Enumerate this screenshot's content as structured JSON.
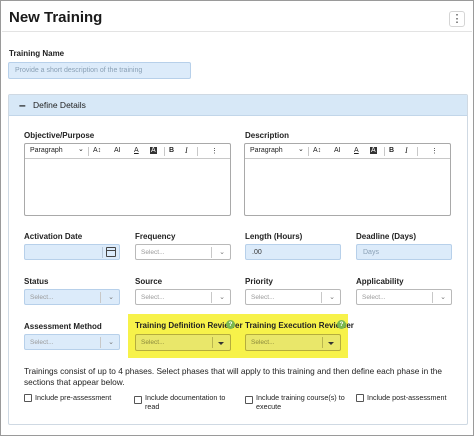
{
  "header": {
    "title": "New Training",
    "menu_icon": "kebab-menu-icon",
    "menu_glyph": "⋮"
  },
  "training_name": {
    "label": "Training Name",
    "placeholder": "Provide a short description of the training"
  },
  "section": {
    "toggle_glyph": "–",
    "title": "Define Details"
  },
  "objective": {
    "label": "Objective/Purpose"
  },
  "description": {
    "label": "Description"
  },
  "editor_toolbar": {
    "paragraph": "Paragraph",
    "chevron": "⌄",
    "font_size": "A↕",
    "font_family": "AI",
    "text_color": "A",
    "highlight": "A",
    "bold": "B",
    "italic": "I",
    "more": "⋮"
  },
  "activation_date": {
    "label": "Activation Date"
  },
  "frequency": {
    "label": "Frequency",
    "placeholder": "Select..."
  },
  "length": {
    "label": "Length (Hours)",
    "value": ".00"
  },
  "deadline": {
    "label": "Deadline (Days)",
    "placeholder": "Days"
  },
  "status": {
    "label": "Status",
    "placeholder": "Select..."
  },
  "source": {
    "label": "Source",
    "placeholder": "Select..."
  },
  "priority": {
    "label": "Priority",
    "placeholder": "Select..."
  },
  "applicability": {
    "label": "Applicability",
    "placeholder": "Select..."
  },
  "assessment_method": {
    "label": "Assessment Method",
    "placeholder": "Select..."
  },
  "definition_reviewer": {
    "label": "Training Definition Reviewer",
    "placeholder": "Select...",
    "help": "?"
  },
  "execution_reviewer": {
    "label": "Training Execution Reviewer",
    "placeholder": "Select...",
    "help": "?"
  },
  "chevron": "⌄",
  "phases_text": "Trainings consist of up to 4 phases. Select phases that will apply to this training and then define each phase in the sections that appear below.",
  "phases": [
    {
      "label": "Include pre-assessment"
    },
    {
      "label": "Include documentation to read"
    },
    {
      "label": "Include training course(s) to execute"
    },
    {
      "label": "Include post-assessment"
    }
  ],
  "colors": {
    "highlight": "#f7f24a",
    "input_fill": "#dcebfa",
    "section_header": "#d7e8f7"
  }
}
